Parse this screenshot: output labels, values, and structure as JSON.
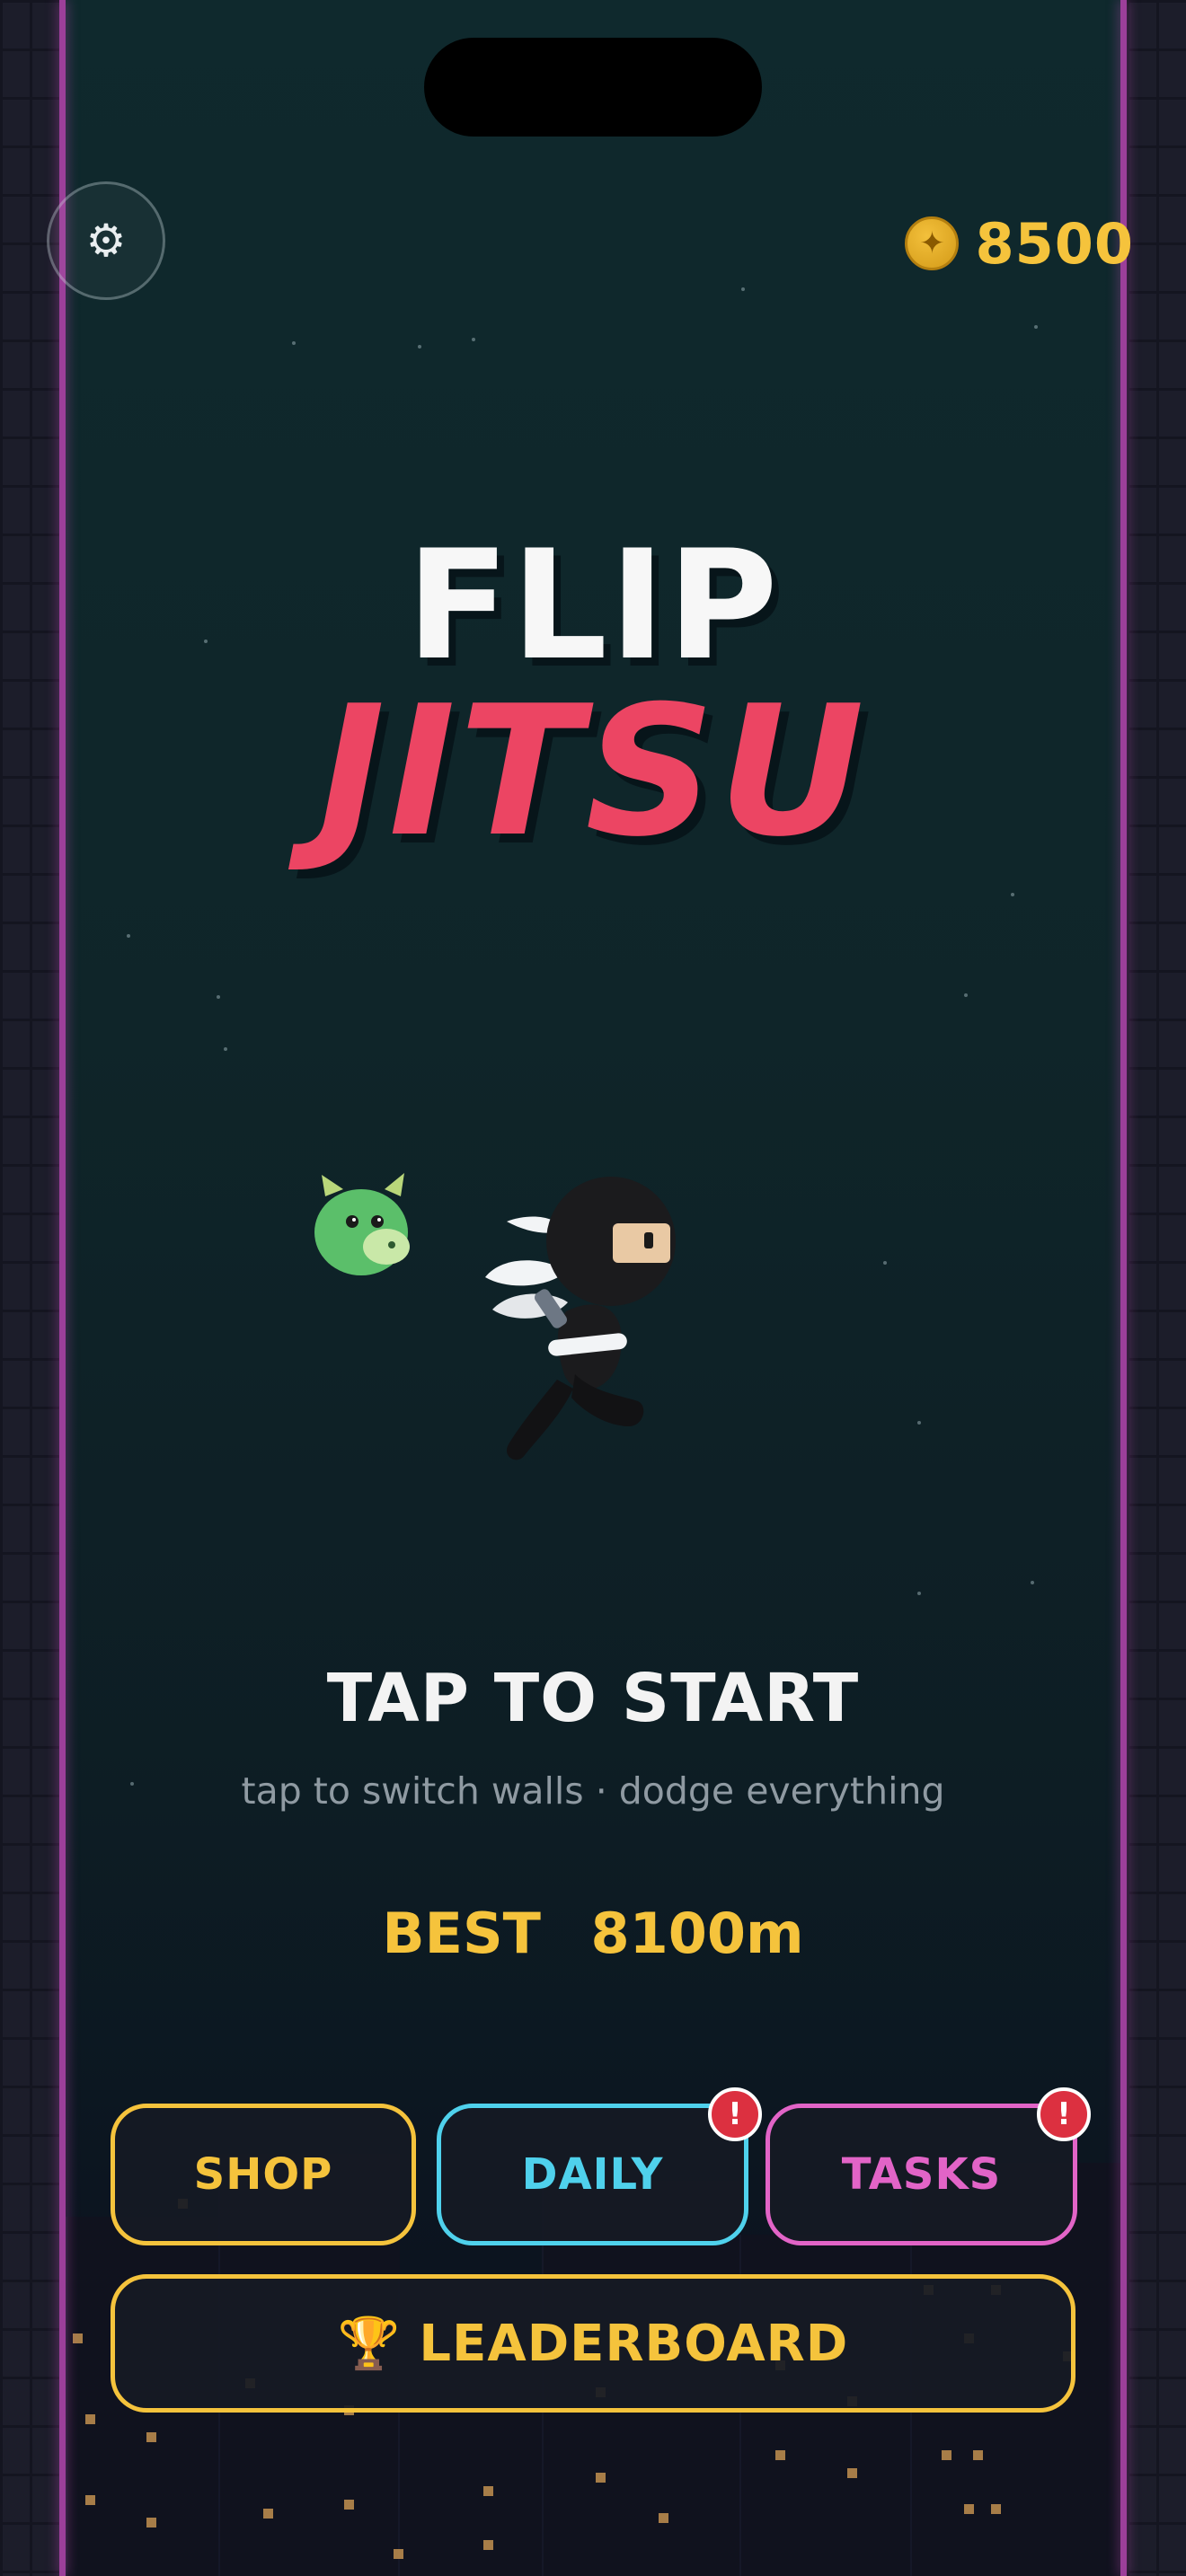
{
  "app": {
    "title_line1": "FLIP",
    "title_line2": "JITSU"
  },
  "hud": {
    "settings_icon": "gear-icon",
    "settings_glyph": "⚙",
    "coin_icon": "coin-icon",
    "coin_glyph": "✦",
    "coins": "8500"
  },
  "start": {
    "prompt": "TAP TO START",
    "hint": "tap to switch walls · dodge everything",
    "best_label": "BEST",
    "best_value": "8100m"
  },
  "menu": {
    "shop": "SHOP",
    "daily": "DAILY",
    "tasks": "TASKS",
    "leaderboard": "LEADERBOARD",
    "leaderboard_icon": "trophy-icon",
    "trophy_glyph": "🏆",
    "badge_glyph": "!",
    "daily_has_alert": true,
    "tasks_has_alert": true
  },
  "colors": {
    "accent_yellow": "#f5c33c",
    "accent_cyan": "#4fd1ec",
    "accent_pink": "#e264c7",
    "title_red": "#ec4563",
    "wall_glow": "#9c3f9a",
    "badge_red": "#dc3040"
  }
}
